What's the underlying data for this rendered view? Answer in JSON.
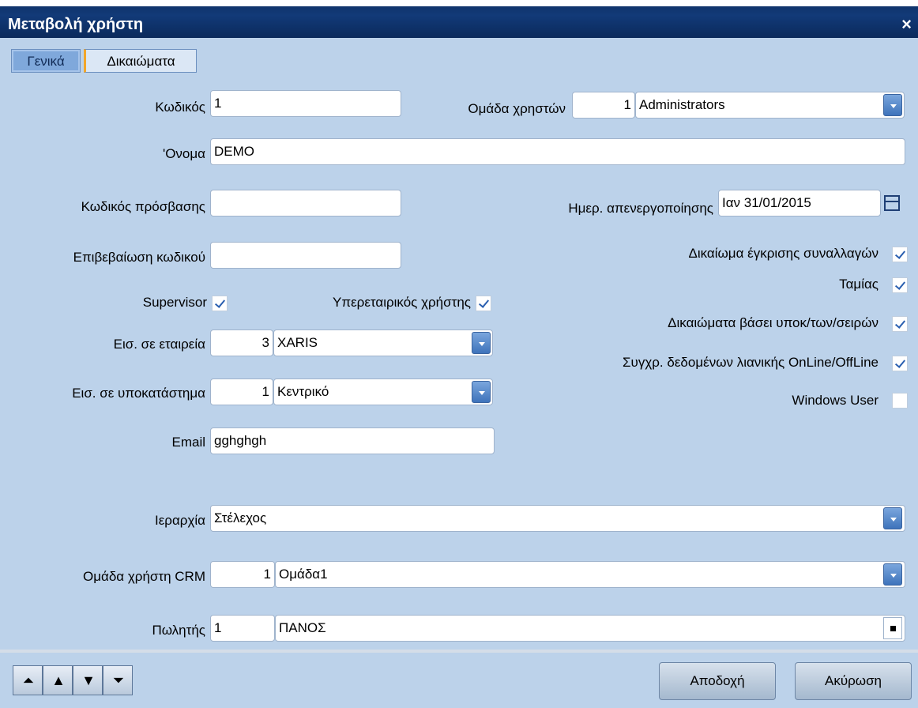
{
  "window": {
    "title": "Μεταβολή χρήστη",
    "close_glyph": "×"
  },
  "tabs": [
    {
      "label": "Γενικά"
    },
    {
      "label": "Δικαιώματα"
    }
  ],
  "form": {
    "code_label": "Κωδικός",
    "code_value": "1",
    "user_group_label": "Ομάδα χρηστών",
    "user_group_code": "1",
    "user_group_name": "Administrators",
    "name_label": "'Ονομα",
    "name_value": "DEMO",
    "password_label": "Κωδικός  πρόσβασης",
    "password_value": "",
    "confirm_label": "Επιβεβαίωση κωδικού",
    "confirm_value": "",
    "deactivation_label": "Ημερ. απενεργοποίησης",
    "deactivation_value": "Ιαν 31/01/2015",
    "approve_tx_label": "Δικαίωμα έγκρισης συναλλαγών",
    "approve_tx_checked": true,
    "cashier_label": "Ταμίας",
    "cashier_checked": true,
    "rights_series_label": "Δικαιώματα βάσει υποκ/των/σειρών",
    "rights_series_checked": true,
    "sync_label": "Συγχρ. δεδομένων λιανικής OnLine/OffLine",
    "sync_checked": true,
    "windows_user_label": "Windows User",
    "windows_user_checked": false,
    "supervisor_label": "Supervisor",
    "supervisor_checked": true,
    "intercompany_label": "Υπερεταιρικός χρήστης",
    "intercompany_checked": true,
    "company_label": "Εισ. σε εταιρεία",
    "company_code": "3",
    "company_name": "XARIS",
    "branch_label": "Εισ. σε υποκατάστημα",
    "branch_code": "1",
    "branch_name": "Κεντρικό",
    "email_label": "Email",
    "email_value": "gghghgh",
    "hierarchy_label": "Ιεραρχία",
    "hierarchy_value": "Στέλεχος",
    "crm_group_label": "Ομάδα χρήστη CRM",
    "crm_group_code": "1",
    "crm_group_name": "Ομάδα1",
    "salesman_label": "Πωλητής",
    "salesman_code": "1",
    "salesman_name": "ΠΑΝΟΣ"
  },
  "nav": {
    "first": "⏶",
    "prev": "▲",
    "next": "▼",
    "last": "⏷"
  },
  "buttons": {
    "accept": "Αποδοχή",
    "cancel": "Ακύρωση"
  },
  "icons": {
    "dropdown": "chevron-down-icon",
    "calendar": "calendar-icon",
    "lookup": "lookup-icon",
    "check": "check-icon"
  }
}
